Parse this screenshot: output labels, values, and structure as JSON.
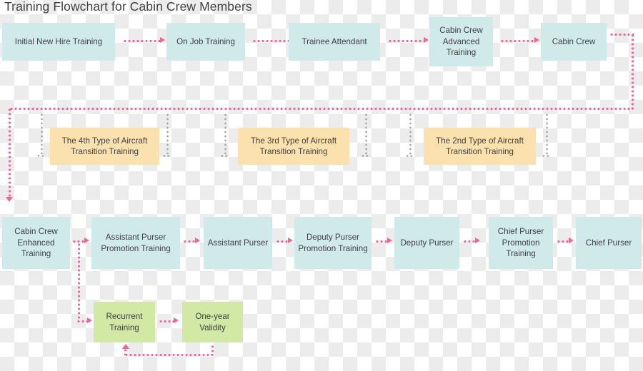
{
  "title": "Training Flowchart for Cabin Crew Members",
  "colors": {
    "blue": "#d0eaea",
    "orange": "#fbe1ad",
    "green": "#d2e9a6",
    "pink_arrow": "#f4629a",
    "gray_arrow": "#a8a8a8",
    "text": "#3f3f41",
    "title_text": "#3f3f3f",
    "checker": "#ececec"
  },
  "rows": {
    "row1": {
      "label": "initial-qualification-track",
      "nodes": [
        {
          "id": "initial-new-hire-training",
          "text": "Initial New Hire Training",
          "type": "blue"
        },
        {
          "id": "on-job-training",
          "text": "On Job Training",
          "type": "blue"
        },
        {
          "id": "trainee-attendant",
          "text": "Trainee Attendant",
          "type": "blue"
        },
        {
          "id": "cabin-crew-advanced-training",
          "text": "Cabin Crew Advanced Training",
          "type": "blue"
        },
        {
          "id": "cabin-crew",
          "text": "Cabin Crew",
          "type": "blue"
        }
      ]
    },
    "row2": {
      "label": "aircraft-transition-track",
      "nodes": [
        {
          "id": "aircraft-transition-4th",
          "text": "The 4th Type of Aircraft Transition Training",
          "type": "orange"
        },
        {
          "id": "aircraft-transition-3rd",
          "text": "The 3rd Type of Aircraft Transition Training",
          "type": "orange"
        },
        {
          "id": "aircraft-transition-2nd",
          "text": "The 2nd Type of Aircraft Transition Training",
          "type": "orange"
        }
      ]
    },
    "row3": {
      "label": "promotion-track",
      "nodes": [
        {
          "id": "cabin-crew-enhanced-training",
          "text": "Cabin Crew Enhanced Training",
          "type": "blue"
        },
        {
          "id": "assistant-purser-promotion-training",
          "text": "Assistant Purser Promotion Training",
          "type": "blue"
        },
        {
          "id": "assistant-purser",
          "text": "Assistant Purser",
          "type": "blue"
        },
        {
          "id": "deputy-purser-promotion-training",
          "text": "Deputy Purser Promotion Training",
          "type": "blue"
        },
        {
          "id": "deputy-purser",
          "text": "Deputy Purser",
          "type": "blue"
        },
        {
          "id": "chief-purser-promotion-training",
          "text": "Chief Purser Promotion Training",
          "type": "blue"
        },
        {
          "id": "chief-purser",
          "text": "Chief Purser",
          "type": "blue"
        }
      ]
    },
    "row4": {
      "label": "recurrent-training-loop",
      "nodes": [
        {
          "id": "recurrent-training",
          "text": "Recurrent Training",
          "type": "green"
        },
        {
          "id": "one-year-validity",
          "text": "One-year Validity",
          "type": "green"
        }
      ]
    }
  }
}
